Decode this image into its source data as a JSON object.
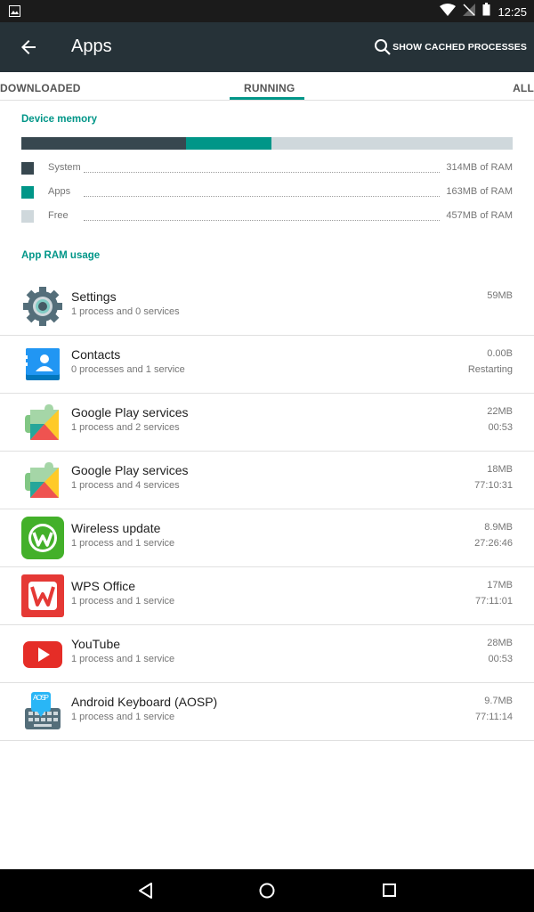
{
  "status_bar": {
    "time": "12:25"
  },
  "app_bar": {
    "title": "Apps",
    "cached_label": "SHOW CACHED PROCESSES"
  },
  "tabs": [
    {
      "label": "DOWNLOADED"
    },
    {
      "label": "RUNNING"
    },
    {
      "label": "ALL"
    }
  ],
  "device_memory": {
    "header": "Device memory",
    "fractions": {
      "system": 0.335,
      "apps": 0.174,
      "free": 0.491
    },
    "colors": {
      "system": "#37474f",
      "apps": "#009688",
      "free": "#cfd8dc"
    },
    "items": [
      {
        "label": "System",
        "value": "314MB of RAM"
      },
      {
        "label": "Apps",
        "value": "163MB of RAM"
      },
      {
        "label": "Free",
        "value": "457MB of RAM"
      }
    ]
  },
  "ram_usage": {
    "header": "App RAM usage",
    "apps": [
      {
        "name": "Settings",
        "sub": "1 process and 0 services",
        "size": "59MB",
        "time": "",
        "icon": "settings-icon"
      },
      {
        "name": "Contacts",
        "sub": "0 processes and 1 service",
        "size": "0.00B",
        "time": "Restarting",
        "icon": "contacts-icon"
      },
      {
        "name": "Google Play services",
        "sub": "1 process and 2 services",
        "size": "22MB",
        "time": "00:53",
        "icon": "play-services-icon"
      },
      {
        "name": "Google Play services",
        "sub": "1 process and 4 services",
        "size": "18MB",
        "time": "77:10:31",
        "icon": "play-services-icon"
      },
      {
        "name": "Wireless update",
        "sub": "1 process and 1 service",
        "size": "8.9MB",
        "time": "27:26:46",
        "icon": "wireless-update-icon"
      },
      {
        "name": "WPS Office",
        "sub": "1 process and 1 service",
        "size": "17MB",
        "time": "77:11:01",
        "icon": "wps-office-icon"
      },
      {
        "name": "YouTube",
        "sub": "1 process and 1 service",
        "size": "28MB",
        "time": "00:53",
        "icon": "youtube-icon"
      },
      {
        "name": "Android Keyboard (AOSP)",
        "sub": "1 process and 1 service",
        "size": "9.7MB",
        "time": "77:11:14",
        "icon": "keyboard-icon",
        "icon_text": "AOSP"
      }
    ]
  },
  "nav_bar": {
    "buttons": [
      "back-icon",
      "home-icon",
      "recents-icon"
    ]
  }
}
